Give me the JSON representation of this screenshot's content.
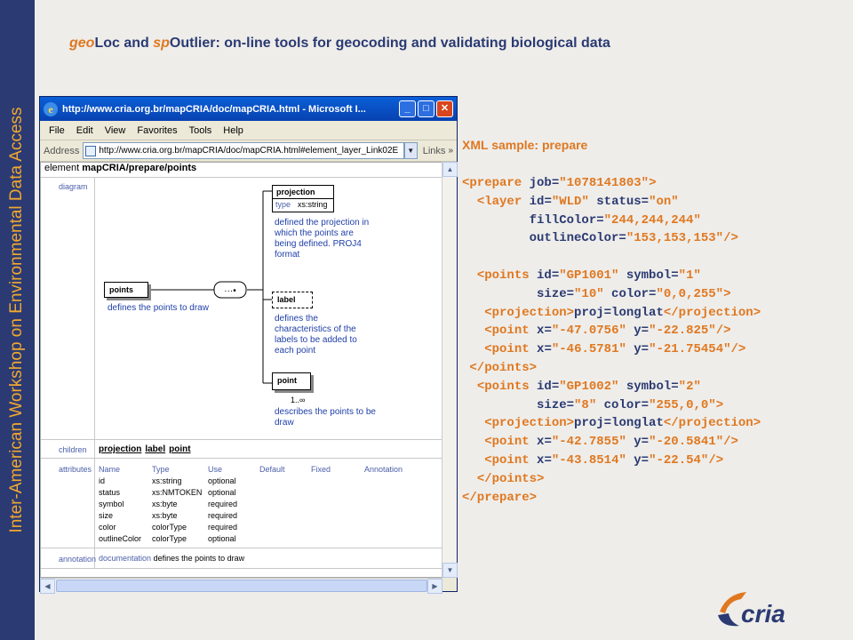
{
  "sidebar_text": "Inter-American Workshop on Environmental Data Access",
  "title": {
    "part1_hl": "geo",
    "part1": "Loc and ",
    "part2_hl": "sp",
    "part2": "Outlier",
    "rest": ": on-line tools for geocoding and validating biological data"
  },
  "browser": {
    "window_title": "http://www.cria.org.br/mapCRIA/doc/mapCRIA.html - Microsoft I...",
    "menu": [
      "File",
      "Edit",
      "View",
      "Favorites",
      "Tools",
      "Help"
    ],
    "address_label": "Address",
    "address_value": "http://www.cria.org.br/mapCRIA/doc/mapCRIA.html#element_layer_Link02E",
    "links_label": "Links",
    "element_prefix": "element ",
    "element_path": "mapCRIA/prepare/points",
    "sections": {
      "diagram": "diagram",
      "children": "children",
      "attributes": "attributes",
      "annotation": "annotation"
    },
    "diagram": {
      "points_label": "points",
      "points_desc": "defines the points to draw",
      "projection_label": "projection",
      "projection_type_key": "type",
      "projection_type_val": "xs:string",
      "projection_desc": "defined the projection in which the points are being defined. PROJ4 format",
      "label_label": "label",
      "label_desc": "defines the characteristics of the labels to be added to each point",
      "point_label": "point",
      "point_mult": "1..∞",
      "point_desc": "describes the points to be draw"
    },
    "children_links": [
      "projection",
      "label",
      "point"
    ],
    "attributes": {
      "headers": [
        "Name",
        "Type",
        "Use",
        "Default",
        "Fixed",
        "Annotation"
      ],
      "rows": [
        [
          "id",
          "xs:string",
          "optional"
        ],
        [
          "status",
          "xs:NMTOKEN",
          "optional"
        ],
        [
          "symbol",
          "xs:byte",
          "required"
        ],
        [
          "size",
          "xs:byte",
          "required"
        ],
        [
          "color",
          "colorType",
          "required"
        ],
        [
          "outlineColor",
          "colorType",
          "optional"
        ]
      ]
    },
    "annotation_key": "documentation",
    "annotation_val": "defines the points to draw"
  },
  "xml_title": "XML sample: prepare",
  "logo_text": "cria",
  "colors": {
    "navy": "#2b3a72",
    "orange": "#e07820",
    "link_blue": "#1f3fa8"
  }
}
